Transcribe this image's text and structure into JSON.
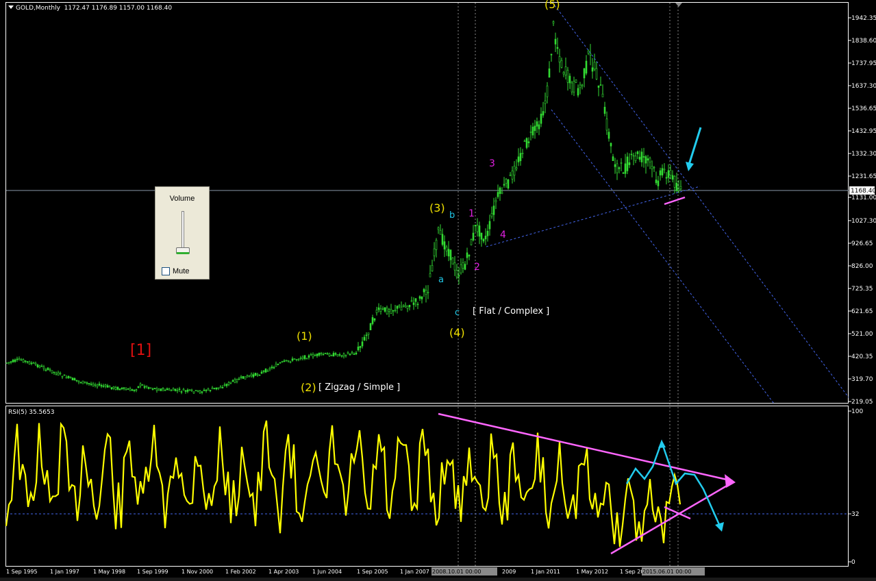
{
  "chart_header": {
    "title": "GOLD,Monthly",
    "ohlc": "1172.47 1176.89 1157.00 1168.40"
  },
  "rsi_header": {
    "label": "RSI(5) 35.5653"
  },
  "price_axis": {
    "labels": [
      "1942.35",
      "1838.60",
      "1737.95",
      "1637.30",
      "1536.65",
      "1432.95",
      "1332.30",
      "1231.65",
      "1131.00",
      "1027.30",
      "926.65",
      "826.00",
      "725.35",
      "621.65",
      "521.00",
      "420.35",
      "319.70",
      "219.05"
    ],
    "current_price": "1168.40"
  },
  "rsi_axis": {
    "labels": [
      "100",
      "32",
      "0"
    ]
  },
  "time_axis": {
    "labels": [
      "1 Sep 1995",
      "1 Jan 1997",
      "1 May 1998",
      "1 Sep 1999",
      "1 Nov 2000",
      "1 Feb 2002",
      "1 Apr 2003",
      "1 Jun 2004",
      "1 Sep 2005",
      "1 Jan 2007",
      "2008.10.01 00:00",
      "2009",
      "1 Jan 2011",
      "1 May 2012",
      "1 Sep 20",
      "2015.06.01 00:00"
    ]
  },
  "wave_labels": [
    {
      "text": "[1]",
      "color": "#e01010"
    },
    {
      "text": "(1)",
      "color": "#f0e000"
    },
    {
      "text": "(2)",
      "color": "#f0e000"
    },
    {
      "text": "[ Zigzag / Simple ]",
      "color": "#ffffff"
    },
    {
      "text": "(3)",
      "color": "#f0e000"
    },
    {
      "text": "b",
      "color": "#20c8e8"
    },
    {
      "text": "a",
      "color": "#20c8e8"
    },
    {
      "text": "c",
      "color": "#20c8e8"
    },
    {
      "text": "(4)",
      "color": "#f0e000"
    },
    {
      "text": "[ Flat / Complex ]",
      "color": "#ffffff"
    },
    {
      "text": "1",
      "color": "#e020e0"
    },
    {
      "text": "2",
      "color": "#e020e0"
    },
    {
      "text": "3",
      "color": "#e020e0"
    },
    {
      "text": "4",
      "color": "#e020e0"
    },
    {
      "text": "(5)",
      "color": "#f0e000"
    }
  ],
  "volume_panel": {
    "title": "Volume",
    "mute_label": "Mute",
    "mute_checked": false
  },
  "colors": {
    "candles": "#33dd33",
    "rsi_line": "#ffff00",
    "trend_magenta": "#ff66ff",
    "arrows_cyan": "#22ccee",
    "channel_blue": "#4466ee"
  }
}
